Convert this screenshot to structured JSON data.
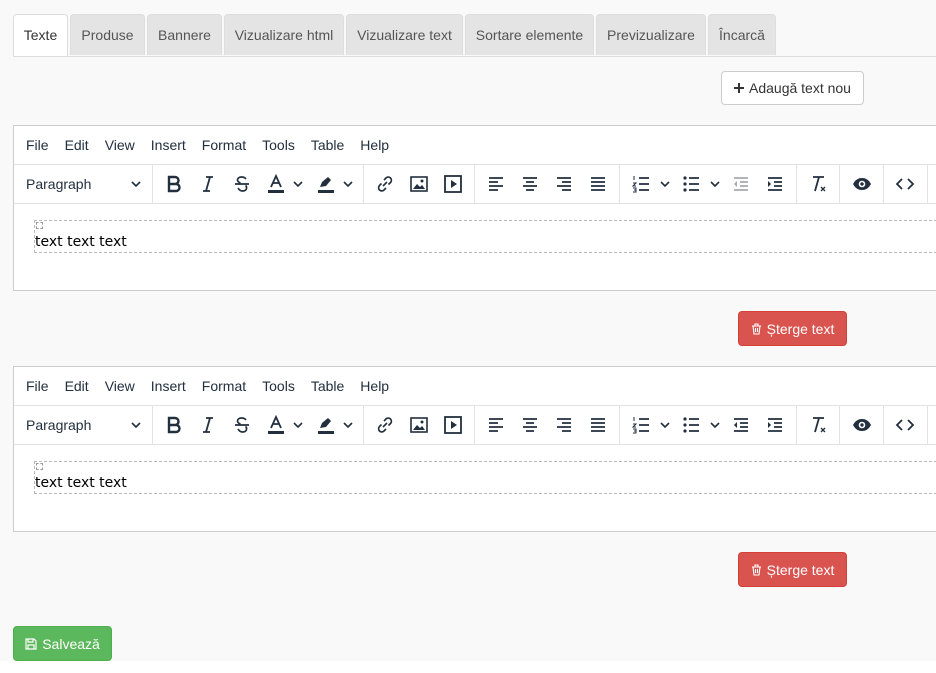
{
  "tabs": [
    {
      "label": "Texte",
      "active": true
    },
    {
      "label": "Produse"
    },
    {
      "label": "Bannere"
    },
    {
      "label": "Vizualizare html"
    },
    {
      "label": "Vizualizare text"
    },
    {
      "label": "Sortare elemente"
    },
    {
      "label": "Previzualizare"
    },
    {
      "label": "Încarcă"
    }
  ],
  "add_text_button": {
    "label": "Adaugă text nou",
    "icon": "plus-icon"
  },
  "editor_menu": [
    "File",
    "Edit",
    "View",
    "Insert",
    "Format",
    "Tools",
    "Table",
    "Help"
  ],
  "block_format": "Paragraph",
  "editors": [
    {
      "content": "text text text",
      "delete_label": "Șterge text"
    },
    {
      "content": "text text text",
      "delete_label": "Șterge text"
    }
  ],
  "save_button": {
    "label": "Salvează",
    "icon": "floppy-icon"
  },
  "colors": {
    "danger": "#d9534f",
    "success": "#5cb85c",
    "tab_inactive": "#e4e4e4"
  }
}
